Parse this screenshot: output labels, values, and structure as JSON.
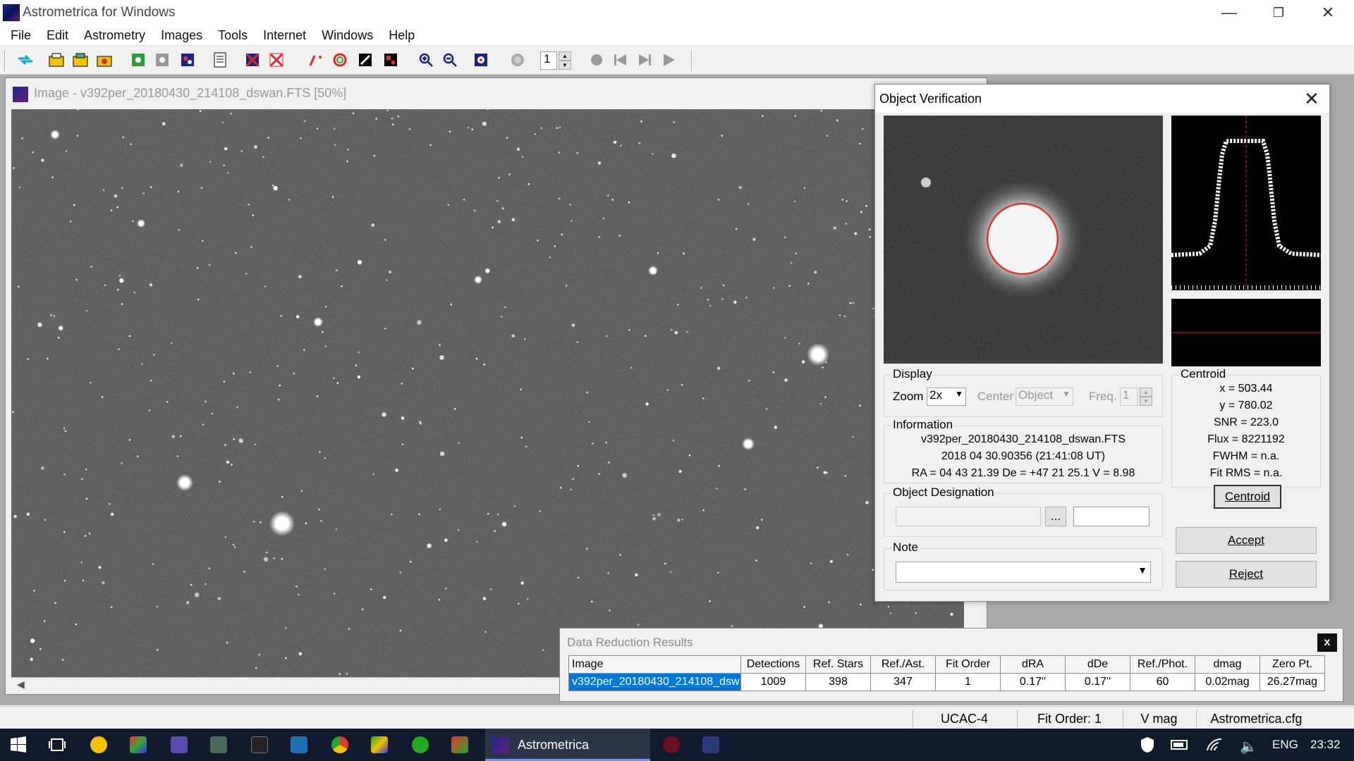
{
  "app": {
    "title": "Astrometrica for Windows"
  },
  "menu": [
    "File",
    "Edit",
    "Astrometry",
    "Images",
    "Tools",
    "Internet",
    "Windows",
    "Help"
  ],
  "toolbar": {
    "frame_spinner_value": "1"
  },
  "image_window": {
    "title": "Image - v392per_20180430_214108_dswan.FTS [50%]"
  },
  "object_verification": {
    "title": "Object Verification",
    "display": {
      "group_label": "Display",
      "zoom_label": "Zoom",
      "zoom_value": "2x",
      "center_label": "Center",
      "center_value": "Object",
      "freq_label": "Freq.",
      "freq_value": "1"
    },
    "information": {
      "group_label": "Information",
      "filename": "v392per_20180430_214108_dswan.FTS",
      "datetime": "2018 04 30.90356 (21:41:08 UT)",
      "coords": "RA = 04 43 21.39   De = +47 21 25.1   V = 8.98"
    },
    "designation": {
      "group_label": "Object Designation",
      "browse_label": "..."
    },
    "note": {
      "group_label": "Note"
    },
    "centroid": {
      "group_label": "Centroid",
      "x": "x = 503.44",
      "y": "y = 780.02",
      "snr": "SNR = 223.0",
      "flux": "Flux = 8221192",
      "fwhm": "FWHM = n.a.",
      "fitrms": "Fit RMS = n.a.",
      "button": "Centroid"
    },
    "accept_label": "Accept",
    "reject_label": "Reject"
  },
  "data_reduction": {
    "title": "Data Reduction Results",
    "close_label": "x",
    "headers": [
      "Image",
      "Detections",
      "Ref. Stars",
      "Ref./Ast.",
      "Fit Order",
      "dRA",
      "dDe",
      "Ref./Phot.",
      "dmag",
      "Zero Pt."
    ],
    "row": [
      "v392per_20180430_214108_dsw",
      "1009",
      "398",
      "347",
      "1",
      "0.17''",
      "0.17''",
      "60",
      "0.02mag",
      "26.27mag"
    ]
  },
  "statusbar": [
    "UCAC-4",
    "Fit Order: 1",
    "V mag",
    "Astrometrica.cfg"
  ],
  "taskbar": {
    "active_app": "Astrometrica",
    "lang": "ENG",
    "time": "23:32"
  }
}
